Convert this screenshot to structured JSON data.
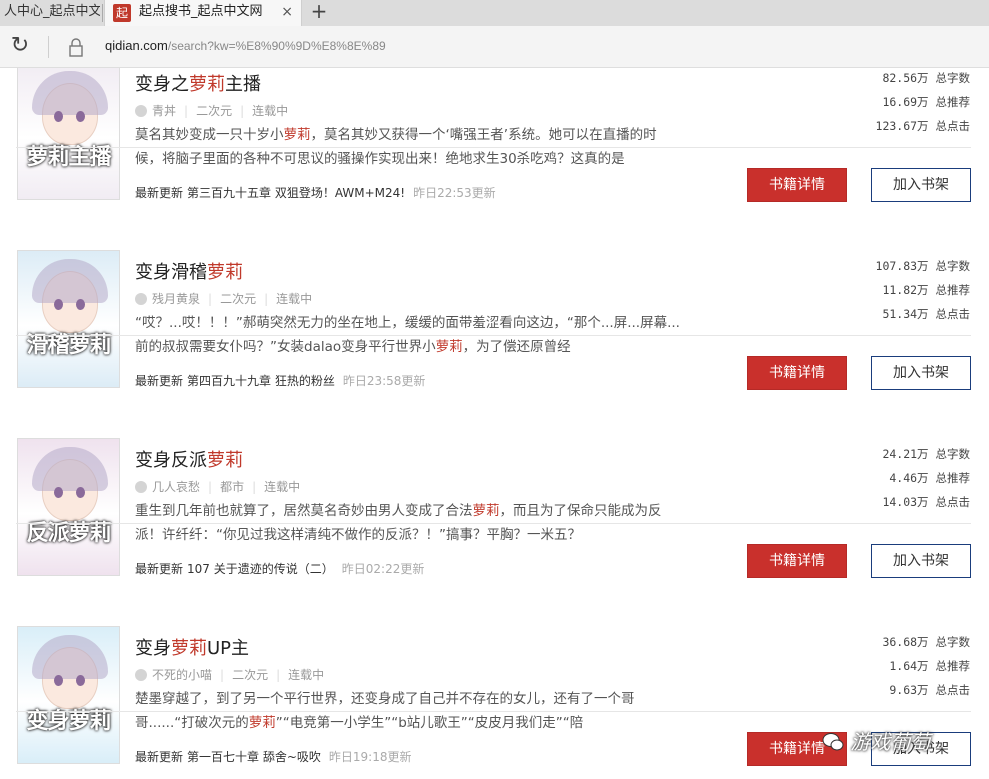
{
  "browser": {
    "inactive_tab": "人中心_起点中文$",
    "active_tab": "起点搜书_起点中文网",
    "favicon_text": "起",
    "close_glyph": "×",
    "newtab_glyph": "+",
    "reload_glyph": "↻",
    "url_host": "qidian.com",
    "url_path": "/search?kw=%E8%90%9D%E8%8E%89"
  },
  "labels": {
    "words": "总字数",
    "recommend": "总推荐",
    "clicks": "总点击",
    "latest": "最新更新",
    "detail_button": "书籍详情",
    "shelf_button": "加入书架"
  },
  "books": [
    {
      "title_pre": "变身之",
      "title_hl": "萝莉",
      "title_post": "主播",
      "author": "青丼",
      "category": "二次元",
      "status": "连载中",
      "desc_pre": "莫名其妙变成一只十岁小",
      "desc_hl": "萝莉",
      "desc_post": "，莫名其妙又获得一个‘嘴强王者’系统。她可以在直播的时候，将脑子里面的各种不可思议的骚操作实现出来！绝地求生30杀吃鸡？这真的是",
      "chapter": "第三百九十五章 双狙登场！AWM+M24!",
      "time": "昨日22:53更新",
      "words": "82.56万",
      "recommend": "16.69万",
      "clicks": "123.67万",
      "cover_text": "萝莉主播",
      "cover_bg": "#f1ecf3"
    },
    {
      "title_pre": "变身滑稽",
      "title_hl": "萝莉",
      "title_post": "",
      "author": "残月黄泉",
      "category": "二次元",
      "status": "连载中",
      "desc_pre": "“哎？...哎！！！”郝萌突然无力的坐在地上，缓缓的面带羞涩看向这边，“那个...屏...屏幕...前的叔叔需要女仆吗？”女装dalao变身平行世界小",
      "desc_hl": "萝莉",
      "desc_post": "，为了偿还原曾经",
      "chapter": "第四百九十九章 狂热的粉丝",
      "time": "昨日23:58更新",
      "words": "107.83万",
      "recommend": "11.82万",
      "clicks": "51.34万",
      "cover_text": "滑稽萝莉",
      "cover_bg": "#dcecf6"
    },
    {
      "title_pre": "变身反派",
      "title_hl": "萝莉",
      "title_post": "",
      "author": "几人哀愁",
      "category": "都市",
      "status": "连载中",
      "desc_pre": "重生到几年前也就算了，居然莫名奇妙由男人变成了合法",
      "desc_hl": "萝莉",
      "desc_post": "，而且为了保命只能成为反派！许纤纤：“你见过我这样清纯不做作的反派？！”搞事？平胸？一米五？",
      "chapter": "107 关于遗迹的传说（二）",
      "time": "昨日02:22更新",
      "words": "24.21万",
      "recommend": "4.46万",
      "clicks": "14.03万",
      "cover_text": "反派萝莉",
      "cover_bg": "#efe2ee"
    },
    {
      "title_pre": "变身",
      "title_hl": "萝莉",
      "title_post": "UP主",
      "author": "不死的小喵",
      "category": "二次元",
      "status": "连载中",
      "desc_pre": "楚墨穿越了，到了另一个平行世界，还变身成了自己并不存在的女儿，还有了一个哥哥......“打破次元的",
      "desc_hl": "萝莉",
      "desc_post": "”“电竞第一小学生”“b站儿歌王”“皮皮月我们走”“陪",
      "chapter": "第一百七十章 舔舍~吸吹",
      "time": "昨日19:18更新",
      "words": "36.68万",
      "recommend": "1.64万",
      "clicks": "9.63万",
      "cover_text": "变身萝莉",
      "cover_bg": "#d9eef8"
    }
  ],
  "watermark": "游戏葡萄"
}
